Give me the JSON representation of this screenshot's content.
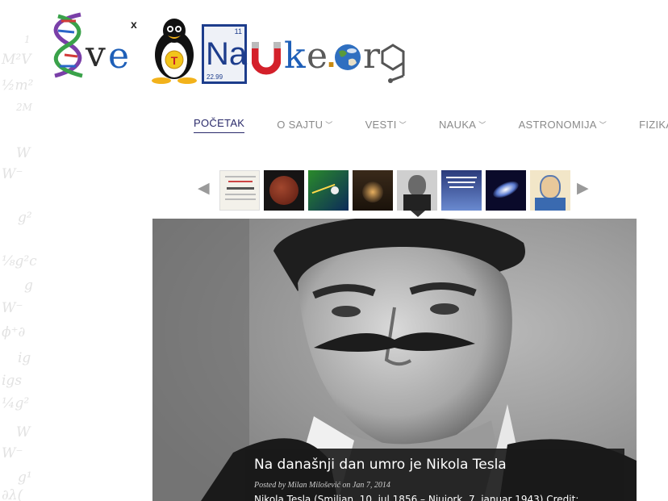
{
  "site": {
    "logo_text": "SvetNauke.org",
    "element_number": "11",
    "element_symbol": "Na",
    "element_mass": "22.99"
  },
  "nav": {
    "items": [
      {
        "label": "POČETAK",
        "active": true,
        "has_dropdown": false
      },
      {
        "label": "O SAJTU",
        "active": false,
        "has_dropdown": true
      },
      {
        "label": "VESTI",
        "active": false,
        "has_dropdown": true
      },
      {
        "label": "NAUKA",
        "active": false,
        "has_dropdown": true
      },
      {
        "label": "ASTRONOMIJA",
        "active": false,
        "has_dropdown": true
      },
      {
        "label": "FIZIKA",
        "active": false,
        "has_dropdown": true
      }
    ]
  },
  "carousel": {
    "prev_icon": "triangle-left-icon",
    "next_icon": "triangle-right-icon",
    "selected_index": 4,
    "thumb_count": 8
  },
  "featured": {
    "title": "Na današnji dan umro je Nikola Tesla",
    "meta": "Posted by Milan Milošević on Jan 7, 2014",
    "excerpt": "Nikola Tesla (Smiljan, 10. jul 1856 – Njujork, 7. januar 1943) Credit:"
  },
  "colors": {
    "nav_active": "#2a2a6a",
    "nav_text": "#8a8a8a",
    "caption_bg": "#191919",
    "logo_blue": "#1d3d8c"
  }
}
